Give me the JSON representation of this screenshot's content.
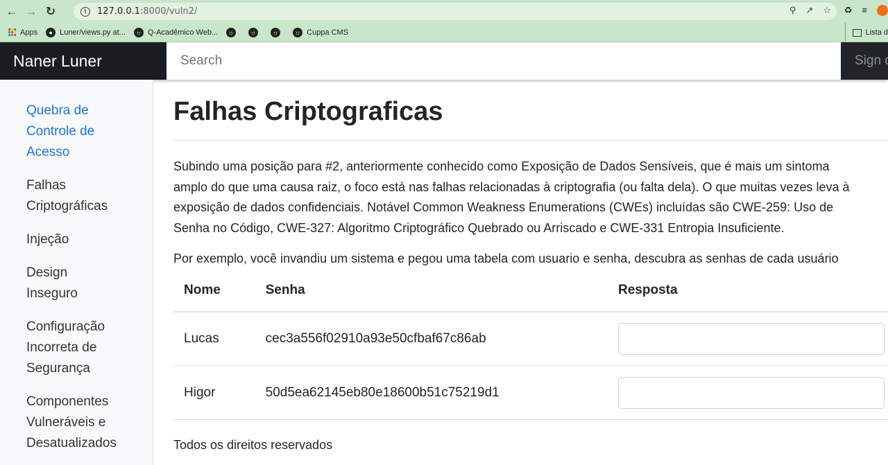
{
  "browser": {
    "url_host": "127.0.0.1",
    "url_rest": ":8000/vuln2/",
    "bookmarks": [
      {
        "label": "Apps"
      },
      {
        "label": "Luner/views.py at..."
      },
      {
        "label": "Q-Acadêmico Web..."
      },
      {
        "label": ""
      },
      {
        "label": ""
      },
      {
        "label": ""
      },
      {
        "label": "Cuppa CMS"
      }
    ],
    "reading_list": "Lista d"
  },
  "navbar": {
    "brand": "Naner Luner",
    "search_placeholder": "Search",
    "signout": "Sign out"
  },
  "sidebar": {
    "items": [
      {
        "label": "Quebra de Controle de Acesso",
        "active": true
      },
      {
        "label": "Falhas Criptográficas"
      },
      {
        "label": "Injeção"
      },
      {
        "label": "Design Inseguro"
      },
      {
        "label": "Configuração Incorreta de Segurança"
      },
      {
        "label": "Componentes Vulneráveis e Desatualizados"
      }
    ]
  },
  "main": {
    "title": "Falhas Criptograficas",
    "paragraph_lines": [
      "Subindo uma posição para #2, anteriormente conhecido como Exposição de Dados Sensíveis, que é mais um sintoma",
      "amplo do que uma causa raiz, o foco está nas falhas relacionadas à criptografia (ou falta dela). O que muitas vezes leva à",
      "exposição de dados confidenciais. Notável Common Weakness Enumerations (CWEs) incluídas são CWE-259: Uso de",
      "Senha no Código, CWE-327: Algoritmo Criptográfico Quebrado ou Arriscado e CWE-331 Entropia Insuficiente."
    ],
    "example": "Por exemplo, você invandiu um sistema e pegou uma tabela com usuario e senha, descubra as senhas de cada usuário",
    "table": {
      "headers": [
        "Nome",
        "Senha",
        "Resposta"
      ],
      "rows": [
        {
          "nome": "Lucas",
          "senha": "cec3a556f02910a93e50cfbaf67c86ab",
          "resposta": ""
        },
        {
          "nome": "Higor",
          "senha": "50d5ea62145eb80e18600b51c75219d1",
          "resposta": ""
        }
      ]
    },
    "footer": "Todos os direitos reservados"
  }
}
